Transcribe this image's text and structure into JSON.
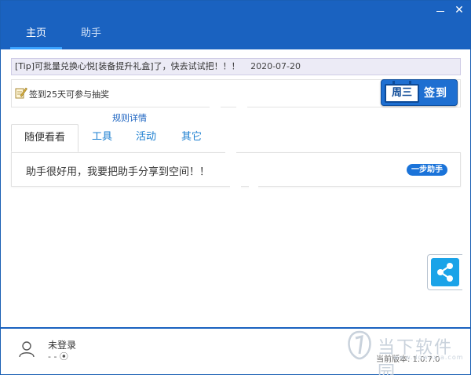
{
  "window": {
    "min_label": "",
    "close_label": "✕"
  },
  "nav": {
    "tabs": [
      {
        "label": "主页",
        "active": true
      },
      {
        "label": "助手",
        "active": false
      }
    ]
  },
  "tip": {
    "text": "[Tip]可批量兑换心悦[装备提升礼盒]了，快去试试把！！！",
    "date": "2020-07-20"
  },
  "sign": {
    "text": "签到25天可参与抽奖",
    "rules_link": "规则详情",
    "weekday": "周三",
    "button_label": "签到"
  },
  "subtabs": [
    {
      "label": "随便看看",
      "active": true
    },
    {
      "label": "工具",
      "active": false
    },
    {
      "label": "活动",
      "active": false
    },
    {
      "label": "其它",
      "active": false
    }
  ],
  "card": {
    "text": "助手很好用，我要把助手分享到空间！！",
    "button_label": "一步助手"
  },
  "footer": {
    "login_status": "未登录",
    "login_sub": "- - ⦿",
    "version": "当前版本: 1.0.7.0"
  },
  "brand": {
    "text": "当下软件园",
    "url": "www.downxia.com"
  },
  "colors": {
    "titlebar": "#1a62c0",
    "accent": "#1a73d9",
    "share": "#1aa3e8"
  }
}
